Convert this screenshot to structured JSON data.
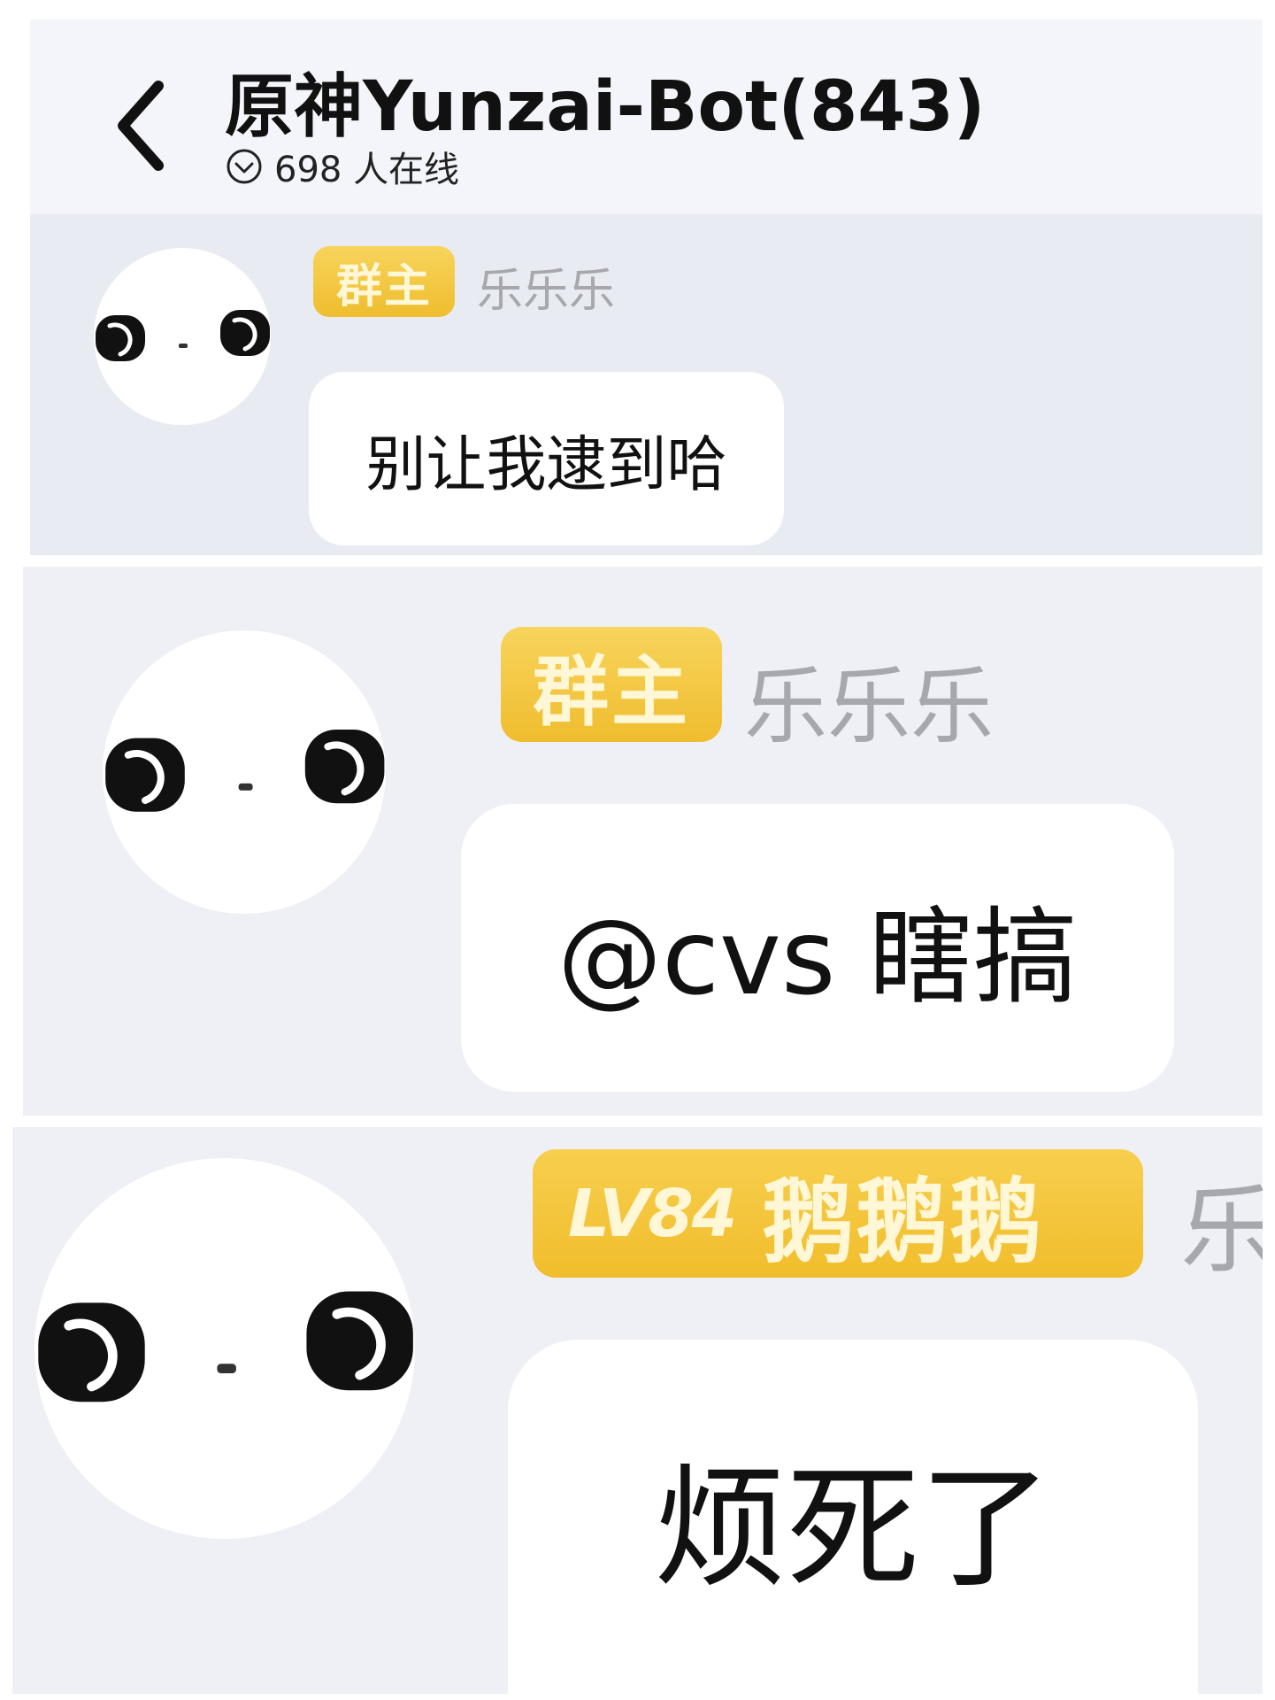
{
  "header": {
    "title": "原神Yunzai-Bot(843)",
    "online_text": "698 人在线",
    "back_icon": "chevron-left-icon",
    "online_icon": "chevron-down-circle-icon"
  },
  "messages": [
    {
      "avatar_icon": "googly-eyes-avatar",
      "badge": "群主",
      "nickname": "乐乐乐",
      "text": "别让我逮到哈"
    },
    {
      "avatar_icon": "googly-eyes-avatar",
      "badge": "群主",
      "nickname": "乐乐乐",
      "text": "@cvs 瞎搞"
    },
    {
      "avatar_icon": "googly-eyes-avatar",
      "badge_level": "LV84",
      "badge_title": "鹅鹅鹅",
      "nickname": "乐",
      "text": "烦死了"
    }
  ],
  "colors": {
    "badge_gold": "#f1bd2c",
    "nickname_gray": "#a6a8ad",
    "panel_bg": "#eef0f6"
  }
}
